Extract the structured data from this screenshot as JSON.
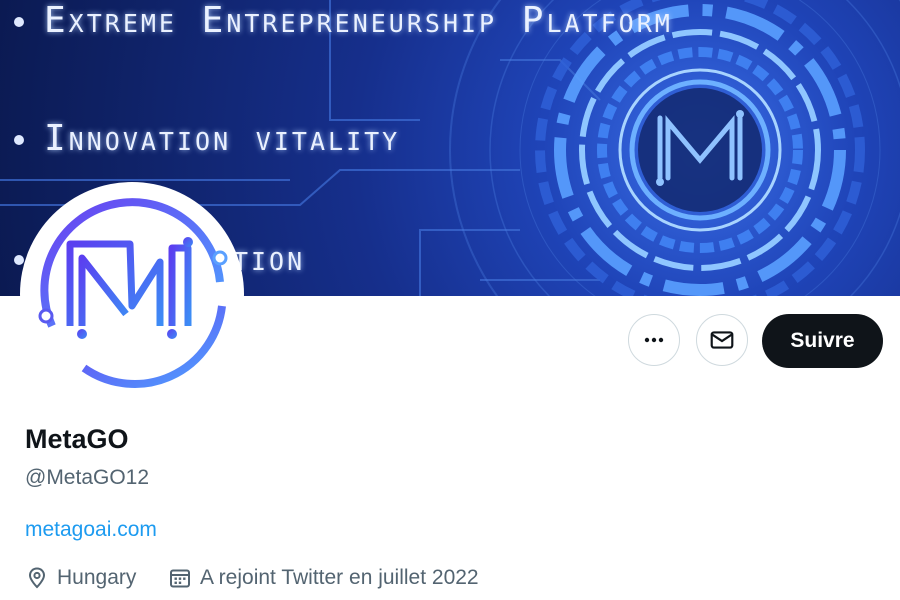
{
  "banner": {
    "lines": [
      "Extreme Entrepreneurship Platform",
      "Innovation vitality",
      "AI Revolution"
    ],
    "logo_letter": "M",
    "colors": {
      "background": "#162f8c",
      "glow": "#5aa0ff"
    }
  },
  "avatar": {
    "logo_letter": "M",
    "ring_colors": [
      "#6a3ef0",
      "#4da3ff"
    ]
  },
  "actions": {
    "more_icon": "more-dots-icon",
    "message_icon": "envelope-icon",
    "follow_label": "Suivre"
  },
  "profile": {
    "display_name": "MetaGO",
    "handle": "@MetaGO12",
    "website": "metagoai.com",
    "location": "Hungary",
    "joined": "A rejoint Twitter en juillet 2022"
  },
  "colors": {
    "link": "#1d9bf0",
    "secondary_text": "#536471",
    "primary_text": "#0f1419"
  }
}
